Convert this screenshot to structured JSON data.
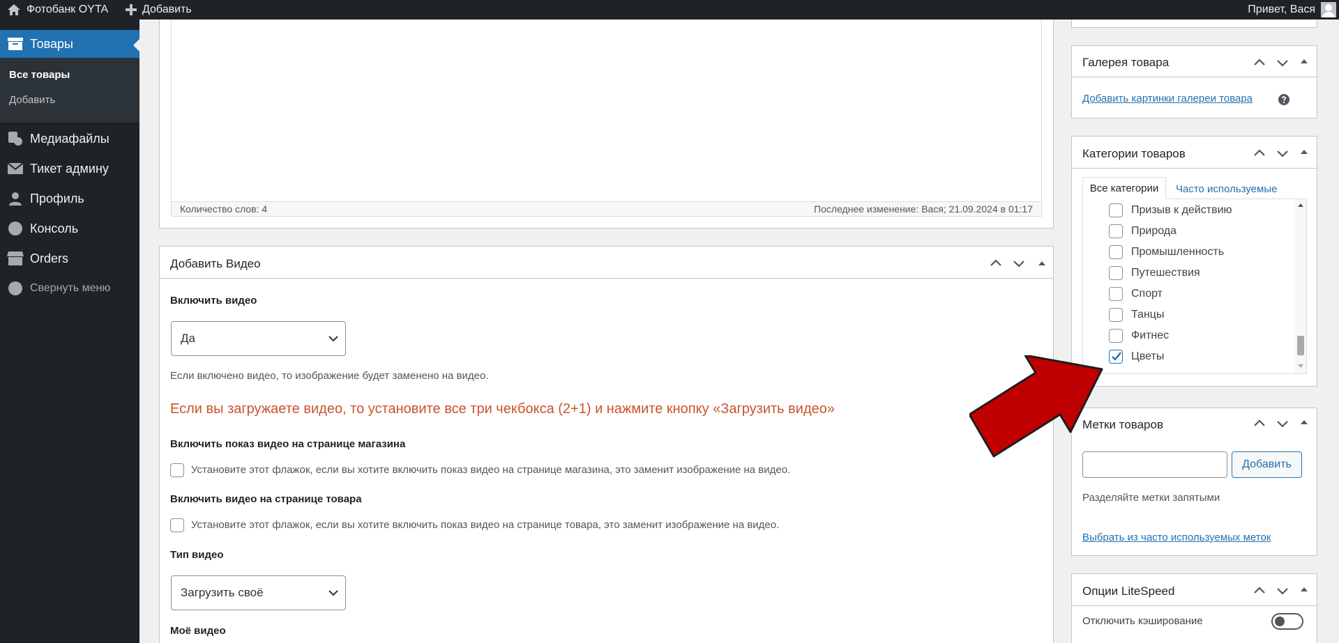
{
  "adminbar": {
    "site_name": "Фотобанк OYTA",
    "add_label": "Добавить",
    "greeting": "Привет, Вася"
  },
  "sidebar": {
    "current": "Товары",
    "submenu": [
      "Все товары",
      "Добавить"
    ],
    "items": [
      "Медиафайлы",
      "Тикет админу",
      "Профиль",
      "Консоль",
      "Orders"
    ],
    "collapse": "Свернуть меню"
  },
  "editor": {
    "word_count": "Количество слов: 4",
    "last_modified": "Последнее изменение: Вася; 21.09.2024 в 01:17"
  },
  "video_box": {
    "title": "Добавить Видео",
    "enable_label": "Включить видео",
    "enable_value": "Да",
    "enable_help": "Если включено видео, то изображение будет заменено на видео.",
    "notice": "Если вы загружаете видео, то установите все три чекбокса (2+1) и нажмите кнопку «Загрузить видео»",
    "shop_label": "Включить показ видео на странице магазина",
    "shop_help": "Установите этот флажок, если вы хотите включить показ видео на странице магазина, это заменит изображение на видео.",
    "product_label": "Включить видео на странице товара",
    "product_help": "Установите этот флажок, если вы хотите включить показ видео на странице товара, это заменит изображение на видео.",
    "type_label": "Тип видео",
    "type_value": "Загрузить своё",
    "my_video_label": "Моё видео"
  },
  "gallery_box": {
    "title": "Галерея товара",
    "add_link": "Добавить картинки галереи товара"
  },
  "categories_box": {
    "title": "Категории товаров",
    "tab_all": "Все категории",
    "tab_popular": "Часто используемые",
    "items": [
      {
        "label": "Призыв к действию",
        "checked": false
      },
      {
        "label": "Природа",
        "checked": false
      },
      {
        "label": "Промышленность",
        "checked": false
      },
      {
        "label": "Путешествия",
        "checked": false
      },
      {
        "label": "Спорт",
        "checked": false
      },
      {
        "label": "Танцы",
        "checked": false
      },
      {
        "label": "Фитнес",
        "checked": false
      },
      {
        "label": "Цветы",
        "checked": true
      }
    ]
  },
  "tags_box": {
    "title": "Метки товаров",
    "input_value": "",
    "add_button": "Добавить",
    "hint": "Разделяйте метки запятыми",
    "popular_link": "Выбрать из часто используемых меток"
  },
  "litespeed_box": {
    "title": "Опции LiteSpeed",
    "disable_cache": "Отключить кэширование"
  },
  "colors": {
    "accent": "#2271b1",
    "notice": "#c9532c",
    "arrow": "#c00000"
  }
}
